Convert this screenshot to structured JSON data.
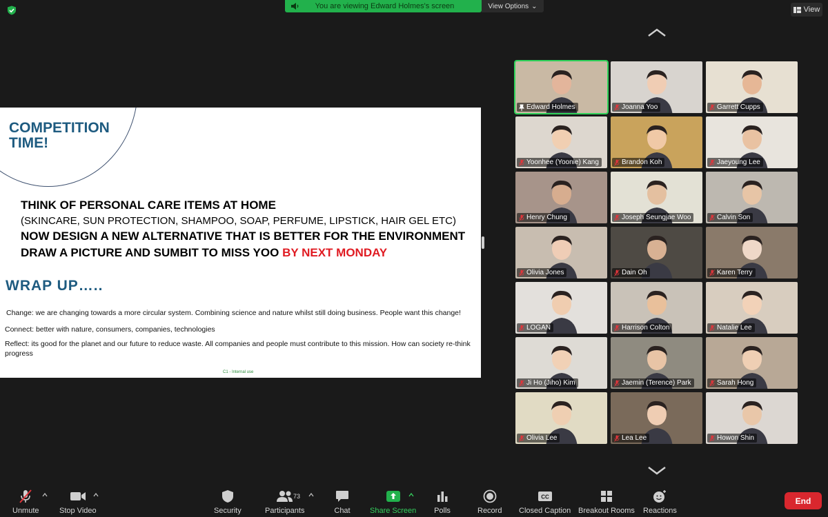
{
  "banner": {
    "text": "You are viewing Edward Holmes's screen",
    "view_options": "View Options"
  },
  "view_button": "View",
  "slide": {
    "title_line1": "COMPETITION",
    "title_line2": "TIME!",
    "task1": "THINK OF PERSONAL CARE ITEMS AT HOME",
    "task2": "(SKINCARE, SUN PROTECTION, SHAMPOO, SOAP, PERFUME, LIPSTICK, HAIR GEL ETC)",
    "task3": "NOW DESIGN A NEW ALTERNATIVE THAT IS BETTER FOR THE ENVIRONMENT",
    "task4_a": "DRAW A PICTURE AND SUMBIT TO MISS YOO ",
    "task4_b": "BY NEXT MONDAY",
    "wrap_title": "WRAP UP…..",
    "change": "Change: we are changing towards a more circular system. Combining science and nature whilst still doing business. People want this change!",
    "connect": "Connect: better with nature, consumers, companies, technologies",
    "reflect": "Reflect: its good for the planet and our future to reduce waste. All companies and people must contribute to this mission. How can society re-think progress",
    "footer": "C1 - Internal use"
  },
  "participants": [
    {
      "name": "Edward Holmes",
      "pinned": true,
      "bg": "#c9b9a4",
      "skin": "#e3b59b"
    },
    {
      "name": "Joanna Yoo",
      "bg": "#d8d4cf",
      "skin": "#f0cdb4"
    },
    {
      "name": "Garrett Cupps",
      "bg": "#e7e0d2",
      "skin": "#e6b796"
    },
    {
      "name": "Yoonhee (Yoonie) Kang",
      "bg": "#ddd7cf",
      "skin": "#f1cfb2"
    },
    {
      "name": "Brandon Koh",
      "bg": "#c9a35c",
      "skin": "#f0c9a6"
    },
    {
      "name": "Jaeyoung Lee",
      "bg": "#e8e4dd",
      "skin": "#e9c2a2"
    },
    {
      "name": "Henry Chung",
      "bg": "#a7948a",
      "skin": "#d7ad8f"
    },
    {
      "name": "Joseph Seungjae Woo",
      "bg": "#e3e1d5",
      "skin": "#e4c0a0"
    },
    {
      "name": "Calvin Son",
      "bg": "#bdb8b0",
      "skin": "#e7c5a6"
    },
    {
      "name": "Olivia Jones",
      "bg": "#c8bdb0",
      "skin": "#efcdb6"
    },
    {
      "name": "Dain Oh",
      "bg": "#4e4a44",
      "skin": "#d8b193"
    },
    {
      "name": "Karen Terry",
      "bg": "#8a7a6a",
      "skin": "#efd8c8"
    },
    {
      "name": "LOGAN",
      "bg": "#e3e0dc",
      "skin": "#f0cdb0"
    },
    {
      "name": "Harrison Colton",
      "bg": "#c9c2b8",
      "skin": "#e9c09b"
    },
    {
      "name": "Natalie Lee",
      "bg": "#d8cdbf",
      "skin": "#f2d2b8"
    },
    {
      "name": "Ji Ho (Jiho) Kim",
      "bg": "#dedbd5",
      "skin": "#f1d1b6"
    },
    {
      "name": "Jaemin (Terence) Park",
      "bg": "#8f8b80",
      "skin": "#e8c4a6"
    },
    {
      "name": "Sarah Hong",
      "bg": "#b8a896",
      "skin": "#efcfb4"
    },
    {
      "name": "Olivia Lee",
      "bg": "#e1dbc4",
      "skin": "#efcfb2"
    },
    {
      "name": "Lea Lee",
      "bg": "#7a6a5a",
      "skin": "#efcdb3"
    },
    {
      "name": "Howon Shin",
      "bg": "#dcd7d2",
      "skin": "#e9c7a9"
    }
  ],
  "toolbar": {
    "unmute": "Unmute",
    "stop_video": "Stop Video",
    "security": "Security",
    "participants": "Participants",
    "participant_count": "73",
    "chat": "Chat",
    "share_screen": "Share Screen",
    "polls": "Polls",
    "record": "Record",
    "closed_caption": "Closed Caption",
    "breakout_rooms": "Breakout Rooms",
    "reactions": "Reactions",
    "end": "End"
  },
  "colors": {
    "accent_green": "#22b14c",
    "end_red": "#d9272e",
    "slide_title_blue": "#1e5b80"
  }
}
